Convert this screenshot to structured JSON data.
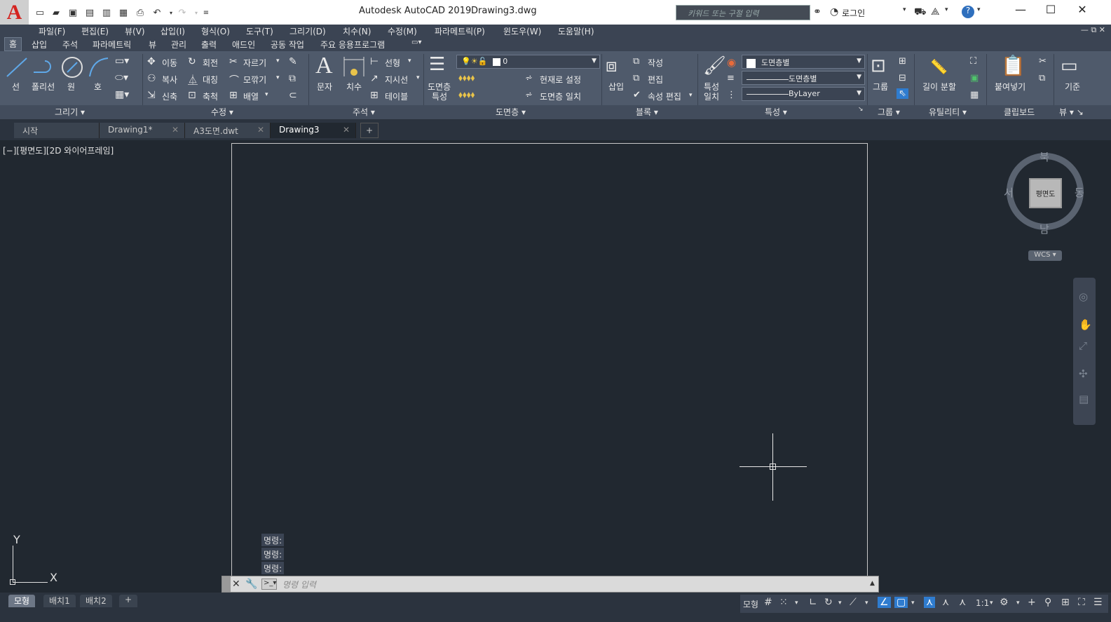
{
  "titlebar": {
    "app_title": "Autodesk AutoCAD 2019",
    "file_name": "Drawing3.dwg",
    "search_placeholder": "키워드 또는 구절 입력",
    "login_label": "로그인"
  },
  "menu": [
    "파일(F)",
    "편집(E)",
    "뷰(V)",
    "삽입(I)",
    "형식(O)",
    "도구(T)",
    "그리기(D)",
    "치수(N)",
    "수정(M)",
    "파라메트릭(P)",
    "윈도우(W)",
    "도움말(H)"
  ],
  "ribbon_tabs": [
    "홈",
    "삽입",
    "주석",
    "파라메트릭",
    "뷰",
    "관리",
    "출력",
    "애드인",
    "공동 작업",
    "주요 응용프로그램"
  ],
  "ribbon": {
    "draw": {
      "line": "선",
      "polyline": "폴리선",
      "circle": "원",
      "arc": "호",
      "panel": "그리기"
    },
    "modify": {
      "move": "이동",
      "rotate": "회전",
      "trim": "자르기",
      "copy": "복사",
      "mirror": "대칭",
      "fillet": "모깎기",
      "stretch": "신축",
      "scale": "축척",
      "array": "배열",
      "panel": "수정"
    },
    "annotation": {
      "text": "문자",
      "dimension": "치수",
      "linear": "선형",
      "leader": "지시선",
      "table": "테이블",
      "panel": "주석"
    },
    "layers": {
      "props_1": "도면층",
      "props_2": "특성",
      "current_layer": "0",
      "make_current": "현재로 설정",
      "match": "도면층 일치",
      "panel": "도면층"
    },
    "block": {
      "insert": "삽입",
      "create": "작성",
      "edit": "편집",
      "attr_edit": "속성 편집",
      "panel": "블록"
    },
    "properties": {
      "match_1": "특성",
      "match_2": "일치",
      "color": "도면층별",
      "linetype": "도면층별",
      "lineweight": "ByLayer",
      "panel": "특성"
    },
    "groups": {
      "group": "그룹",
      "panel": "그룹"
    },
    "utilities": {
      "measure": "길이 분할",
      "panel": "유틸리티"
    },
    "clipboard": {
      "paste": "붙여넣기",
      "panel": "클립보드"
    },
    "view": {
      "base": "기준",
      "panel": "뷰"
    }
  },
  "doc_tabs": [
    "시작",
    "Drawing1*",
    "A3도면.dwt",
    "Drawing3"
  ],
  "viewport": {
    "label": "[−][평면도][2D 와이어프레임]",
    "viewcube": {
      "north": "북",
      "south": "남",
      "east": "동",
      "west": "서",
      "face": "평면도",
      "wcs": "WCS"
    },
    "ucs_x": "X",
    "ucs_y": "Y"
  },
  "command": {
    "history": [
      "명령:",
      "명령:",
      "명령:"
    ],
    "placeholder": "명령 입력"
  },
  "layout_tabs": [
    "모형",
    "배치1",
    "배치2"
  ],
  "status": {
    "model": "모형",
    "scale": "1:1"
  }
}
